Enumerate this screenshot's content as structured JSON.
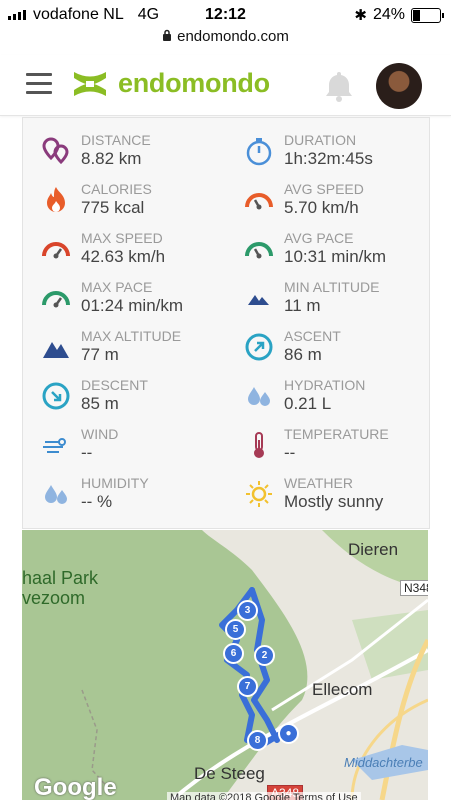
{
  "status_bar": {
    "carrier": "vodafone NL",
    "network": "4G",
    "time": "12:12",
    "battery": "24%",
    "battery_level": 0.24
  },
  "url": "endomondo.com",
  "header": {
    "logo_text": "endomondo"
  },
  "stats": [
    {
      "key": "distance",
      "label": "DISTANCE",
      "value": "8.82 km",
      "icon": "map-pin-icon"
    },
    {
      "key": "duration",
      "label": "DURATION",
      "value": "1h:32m:45s",
      "icon": "stopwatch-icon"
    },
    {
      "key": "calories",
      "label": "CALORIES",
      "value": "775 kcal",
      "icon": "flame-icon"
    },
    {
      "key": "avg-speed",
      "label": "AVG SPEED",
      "value": "5.70 km/h",
      "icon": "gauge-icon"
    },
    {
      "key": "max-speed",
      "label": "MAX SPEED",
      "value": "42.63 km/h",
      "icon": "gauge-icon"
    },
    {
      "key": "avg-pace",
      "label": "AVG PACE",
      "value": "10:31 min/km",
      "icon": "gauge-icon"
    },
    {
      "key": "max-pace",
      "label": "MAX PACE",
      "value": "01:24 min/km",
      "icon": "gauge-icon"
    },
    {
      "key": "min-altitude",
      "label": "MIN ALTITUDE",
      "value": "11 m",
      "icon": "mountain-icon"
    },
    {
      "key": "max-altitude",
      "label": "MAX ALTITUDE",
      "value": "77 m",
      "icon": "mountain-icon"
    },
    {
      "key": "ascent",
      "label": "ASCENT",
      "value": "86 m",
      "icon": "ascent-arrow-icon"
    },
    {
      "key": "descent",
      "label": "DESCENT",
      "value": "85 m",
      "icon": "descent-arrow-icon"
    },
    {
      "key": "hydration",
      "label": "HYDRATION",
      "value": "0.21 L",
      "icon": "drops-icon"
    },
    {
      "key": "wind",
      "label": "WIND",
      "value": "--",
      "icon": "wind-icon"
    },
    {
      "key": "temperature",
      "label": "TEMPERATURE",
      "value": "--",
      "icon": "thermometer-icon"
    },
    {
      "key": "humidity",
      "label": "HUMIDITY",
      "value": "-- %",
      "icon": "drops-icon"
    },
    {
      "key": "weather",
      "label": "WEATHER",
      "value": "Mostly sunny",
      "icon": "sun-icon"
    }
  ],
  "map": {
    "places": {
      "dieren": "Dieren",
      "park_line1": "haal Park",
      "park_line2": "vezoom",
      "ellecom": "Ellecom",
      "de_steeg": "De Steeg",
      "middachter": "Middachterbe"
    },
    "roads": {
      "n348": "N348",
      "a348": "A348"
    },
    "markers": [
      "3",
      "5",
      "6",
      "2",
      "7",
      "8"
    ],
    "google": "Google",
    "footer": "Map data ©2018 Google    Terms of Use"
  },
  "colors": {
    "brand_green": "#8bbd24",
    "route_blue": "#3a6fd8",
    "map_green": "#a9c694"
  }
}
